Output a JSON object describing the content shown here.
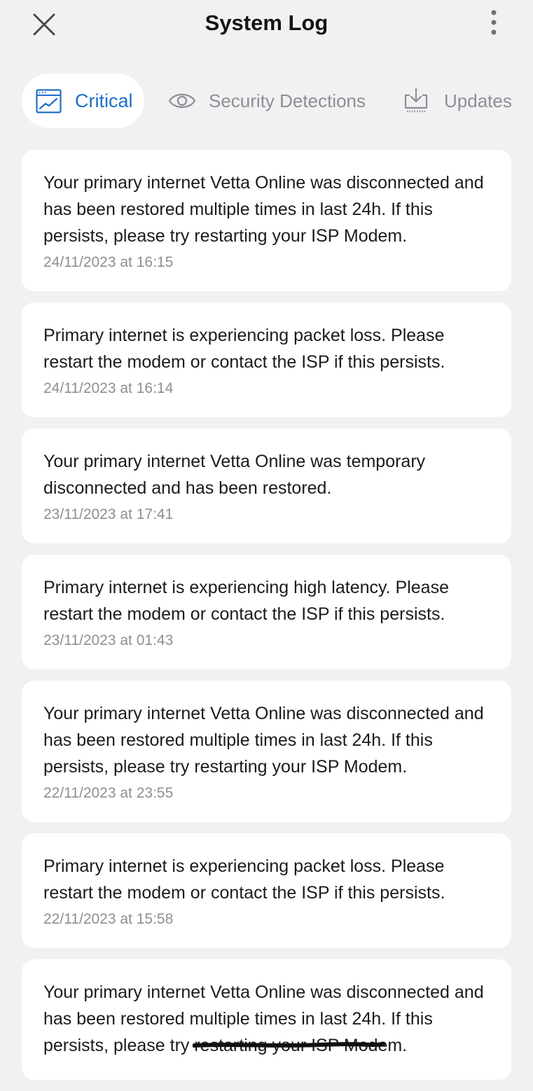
{
  "header": {
    "title": "System Log",
    "close_icon": "close-icon",
    "more_icon": "more-vertical-icon"
  },
  "tabs": [
    {
      "label": "Critical",
      "icon": "chart-window-icon",
      "active": true
    },
    {
      "label": "Security Detections",
      "icon": "eye-icon",
      "active": false
    },
    {
      "label": "Updates",
      "icon": "download-tray-icon",
      "active": false
    }
  ],
  "logs": [
    {
      "message": "Your primary internet Vetta Online was disconnected and has been restored multiple times in last 24h. If this persists, please try restarting your ISP Modem.",
      "time": "24/11/2023 at 16:15"
    },
    {
      "message": "Primary internet is experiencing packet loss. Please restart the modem or contact the ISP if this persists.",
      "time": "24/11/2023 at 16:14"
    },
    {
      "message": "Your primary internet Vetta Online was temporary disconnected and has been restored.",
      "time": "23/11/2023 at 17:41"
    },
    {
      "message": "Primary internet is experiencing high latency. Please restart the modem or contact the ISP if this persists.",
      "time": "23/11/2023 at 01:43"
    },
    {
      "message": "Your primary internet Vetta Online was disconnected and has been restored multiple times in last 24h. If this persists, please try restarting your ISP Modem.",
      "time": "22/11/2023 at 23:55"
    },
    {
      "message": "Primary internet is experiencing packet loss. Please restart the modem or contact the ISP if this persists.",
      "time": "22/11/2023 at 15:58"
    },
    {
      "message": "Your primary internet Vetta Online was disconnected and has been restored multiple times in last 24h. If this persists, please try restarting your ISP Modem.",
      "time": ""
    }
  ],
  "colors": {
    "accent": "#1f6fc8",
    "background": "#f1f1f3",
    "card": "#ffffff",
    "muted_text": "#8e8e93"
  }
}
